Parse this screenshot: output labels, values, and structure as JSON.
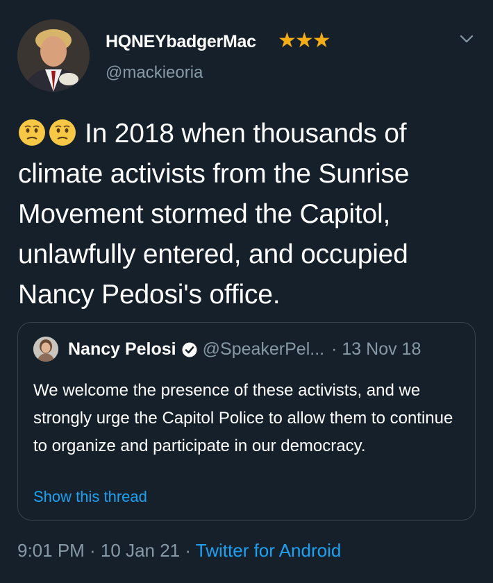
{
  "author": {
    "display_name": "HQNEYbadgerMac",
    "stars": "★★★",
    "handle": "@mackieoria",
    "avatar_icon": "profile-photo"
  },
  "tweet": {
    "emoji": [
      "confused-face-emoji",
      "confused-face-emoji"
    ],
    "text": "In 2018 when thousands of climate activists from the Sunrise Movement stormed the Capitol, unlawfully entered, and occupied Nancy Pedosi's office."
  },
  "quoted_tweet": {
    "display_name": "Nancy Pelosi",
    "verified_icon": "verified-badge-icon",
    "handle": "@SpeakerPel...",
    "date": "· 13 Nov 18",
    "text": "We welcome the presence of these activists, and we strongly urge the Capitol Police to allow them to continue to organize and participate in our democracy.",
    "show_thread": "Show this thread"
  },
  "footer": {
    "time_date": "9:01 PM · 10 Jan 21 · ",
    "source": "Twitter for Android"
  },
  "colors": {
    "background": "#15202b",
    "secondary_text": "#8899a6",
    "link": "#1da1f2",
    "stars": "#f4ad16"
  }
}
